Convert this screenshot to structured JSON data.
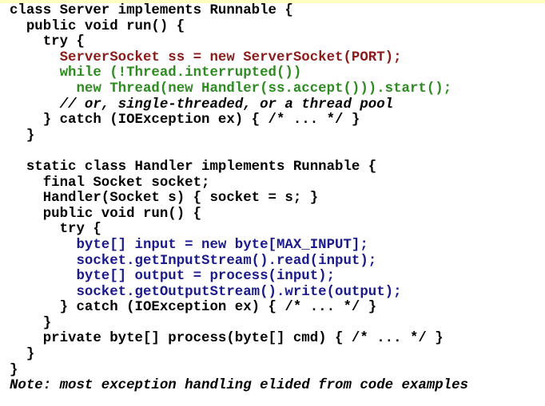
{
  "colors": {
    "default": "#000000",
    "red": "#8b1a1a",
    "green": "#2e8b22",
    "blue": "#1a1a8b"
  },
  "lines": [
    {
      "indent": 0,
      "color": "default",
      "text": "class Server implements Runnable {"
    },
    {
      "indent": 1,
      "color": "default",
      "text": "public void run() {"
    },
    {
      "indent": 2,
      "color": "default",
      "text": "try {"
    },
    {
      "indent": 3,
      "color": "red",
      "text": "ServerSocket ss = new ServerSocket(PORT);"
    },
    {
      "indent": 3,
      "color": "green",
      "text": "while (!Thread.interrupted())"
    },
    {
      "indent": 4,
      "color": "green",
      "text": "new Thread(new Handler(ss.accept())).start();"
    },
    {
      "indent": 3,
      "color": "default",
      "style": "comment",
      "text": "// or, single-threaded, or a thread pool"
    },
    {
      "indent": 2,
      "color": "default",
      "text": "} catch (IOException ex) { /* ... */ }"
    },
    {
      "indent": 1,
      "color": "default",
      "text": "}"
    },
    {
      "indent": 0,
      "color": "default",
      "text": ""
    },
    {
      "indent": 1,
      "color": "default",
      "text": "static class Handler implements Runnable {"
    },
    {
      "indent": 2,
      "color": "default",
      "text": "final Socket socket;"
    },
    {
      "indent": 2,
      "color": "default",
      "text": "Handler(Socket s) { socket = s; }"
    },
    {
      "indent": 2,
      "color": "default",
      "text": "public void run() {"
    },
    {
      "indent": 3,
      "color": "default",
      "text": "try {"
    },
    {
      "indent": 4,
      "color": "blue",
      "text": "byte[] input = new byte[MAX_INPUT];"
    },
    {
      "indent": 4,
      "color": "blue",
      "text": "socket.getInputStream().read(input);"
    },
    {
      "indent": 4,
      "color": "blue",
      "text": "byte[] output = process(input);"
    },
    {
      "indent": 4,
      "color": "blue",
      "text": "socket.getOutputStream().write(output);"
    },
    {
      "indent": 3,
      "color": "default",
      "text": "} catch (IOException ex) { /* ... */ }"
    },
    {
      "indent": 2,
      "color": "default",
      "text": "}"
    },
    {
      "indent": 2,
      "color": "default",
      "text": "private byte[] process(byte[] cmd) { /* ... */ }"
    },
    {
      "indent": 1,
      "color": "default",
      "text": "}"
    },
    {
      "indent": 0,
      "color": "default",
      "text": "}"
    },
    {
      "indent": 0,
      "color": "default",
      "style": "note",
      "text": "Note: most exception handling elided from code examples"
    }
  ]
}
